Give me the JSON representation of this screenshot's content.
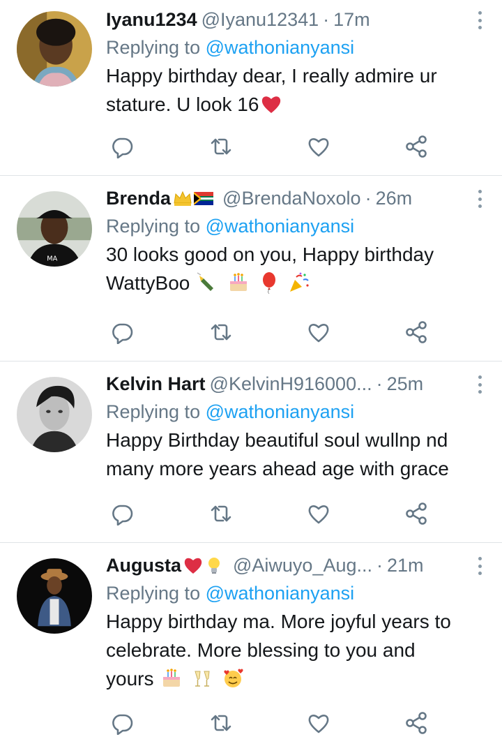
{
  "tweets": [
    {
      "name": "Iyanu1234",
      "badges": [],
      "handle": "@Iyanu12341",
      "time": "17m",
      "replying_prefix": "Replying to",
      "replying_to": "@wathonianyansi",
      "text_lines": [
        "Happy birthday dear, I really admire ur",
        "stature. U look 16"
      ],
      "trailing_emojis": [
        "red-heart"
      ]
    },
    {
      "name": "Brenda",
      "badges": [
        "crown",
        "south-africa-flag"
      ],
      "handle": "@BrendaNoxolo",
      "time": "26m",
      "replying_prefix": "Replying to",
      "replying_to": "@wathonianyansi",
      "text_lines": [
        "30 looks good on you, Happy birthday",
        "WattyBoo"
      ],
      "trailing_emojis": [
        "champagne-bottle",
        "birthday-cake",
        "balloon",
        "party-popper"
      ]
    },
    {
      "name": "Kelvin Hart",
      "badges": [],
      "handle": "@KelvinH916000...",
      "time": "25m",
      "replying_prefix": "Replying to",
      "replying_to": "@wathonianyansi",
      "text_lines": [
        "Happy Birthday beautiful soul wullnp nd",
        "many more years ahead age with grace"
      ],
      "trailing_emojis": []
    },
    {
      "name": "Augusta",
      "badges": [
        "red-heart",
        "light-bulb"
      ],
      "handle": "@Aiwuyo_Aug...",
      "time": "21m",
      "replying_prefix": "Replying to",
      "replying_to": "@wathonianyansi",
      "text_lines": [
        "Happy birthday ma. More joyful years to",
        "celebrate. More blessing to you and",
        "yours"
      ],
      "trailing_emojis": [
        "birthday-cake",
        "clinking-glasses",
        "smiling-face-with-hearts"
      ]
    }
  ],
  "icons": {
    "reply": "reply-icon",
    "retweet": "retweet-icon",
    "like": "like-icon",
    "share": "share-icon",
    "more": "more-options-icon"
  },
  "colors": {
    "text": "#14171a",
    "secondary": "#657786",
    "link": "#1da1f2",
    "icon": "#657786",
    "divider": "#dfe3e6"
  }
}
